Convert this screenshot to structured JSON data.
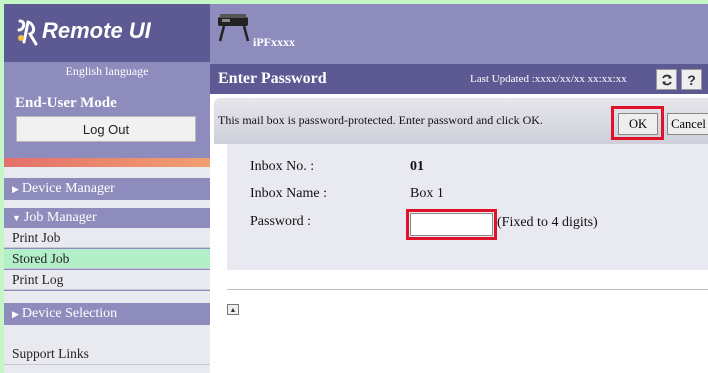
{
  "sidebar": {
    "logo": "Remote UI",
    "language": "English language",
    "mode": "End-User Mode",
    "logout_label": "Log Out",
    "device_manager": "Device Manager",
    "job_manager": "Job Manager",
    "job_items": [
      "Print Job",
      "Stored Job",
      "Print Log"
    ],
    "device_selection": "Device Selection",
    "support_links": "Support Links"
  },
  "header": {
    "model": "iPFxxxx",
    "title": "Enter Password",
    "last_updated": "Last Updated :xxxx/xx/xx xx:xx:xx"
  },
  "message": {
    "text": "This mail box is password-protected. Enter password and click OK.",
    "ok_label": "OK",
    "cancel_label": "Cancel"
  },
  "form": {
    "inbox_no_label": "Inbox No. :",
    "inbox_no_value": "01",
    "inbox_name_label": "Inbox Name :",
    "inbox_name_value": "Box 1",
    "password_label": "Password :",
    "password_value": "",
    "password_hint": "(Fixed to 4 digits)"
  },
  "colors": {
    "accent": "#5d5a93",
    "highlight": "#e0122a",
    "selected_item": "#b3f0c9"
  }
}
